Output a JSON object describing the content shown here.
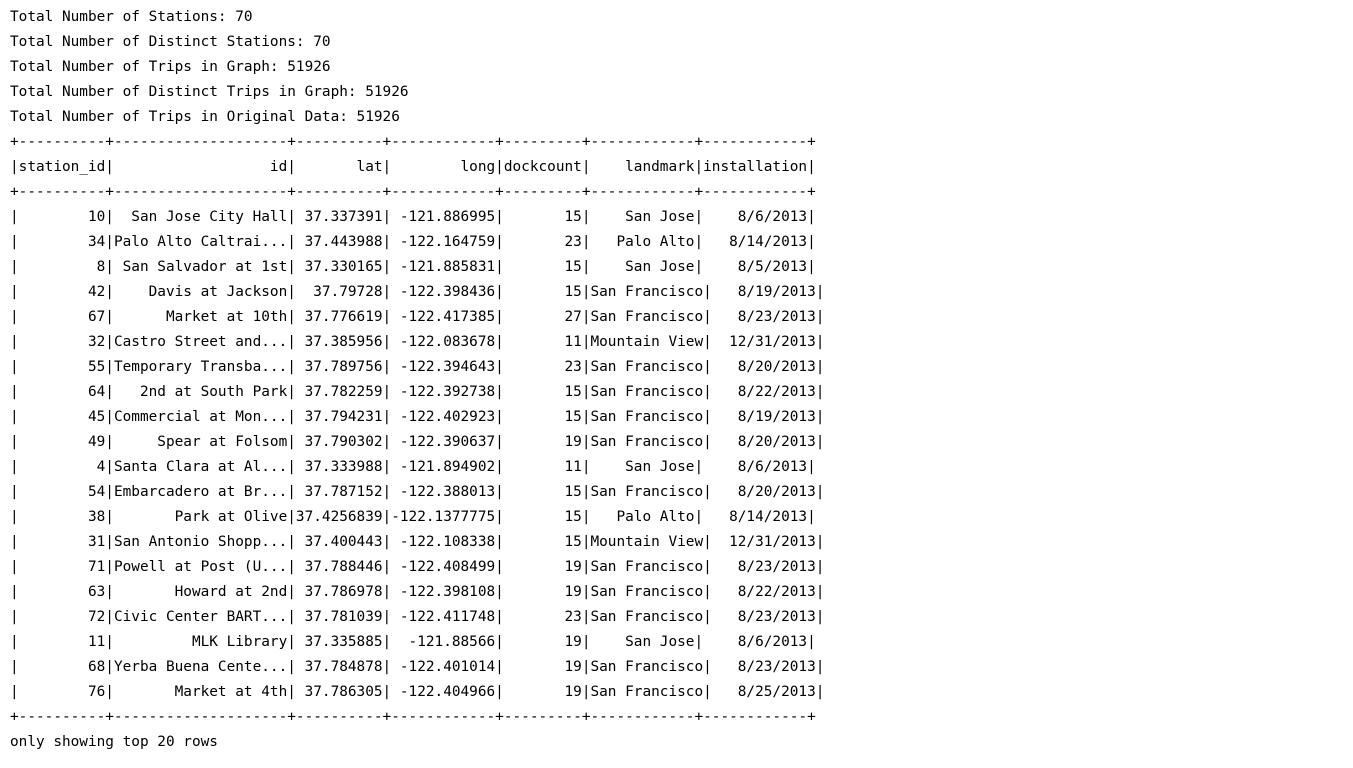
{
  "summary": [
    "Total Number of Stations: 70",
    "Total Number of Distinct Stations: 70",
    "Total Number of Trips in Graph: 51926",
    "Total Number of Distinct Trips in Graph: 51926",
    "Total Number of Trips in Original Data: 51926"
  ],
  "table": {
    "border": "+----------+--------------------+----------+------------+---------+------------+------------+",
    "header": "|station_id|                  id|       lat|        long|dockcount|    landmark|installation|",
    "rows": [
      "|        10|  San Jose City Hall| 37.337391| -121.886995|       15|    San Jose|    8/6/2013|",
      "|        34|Palo Alto Caltrai...| 37.443988| -122.164759|       23|   Palo Alto|   8/14/2013|",
      "|         8| San Salvador at 1st| 37.330165| -121.885831|       15|    San Jose|    8/5/2013|",
      "|        42|    Davis at Jackson|  37.79728| -122.398436|       15|San Francisco|   8/19/2013|",
      "|        67|      Market at 10th| 37.776619| -122.417385|       27|San Francisco|   8/23/2013|",
      "|        32|Castro Street and...| 37.385956| -122.083678|       11|Mountain View|  12/31/2013|",
      "|        55|Temporary Transba...| 37.789756| -122.394643|       23|San Francisco|   8/20/2013|",
      "|        64|   2nd at South Park| 37.782259| -122.392738|       15|San Francisco|   8/22/2013|",
      "|        45|Commercial at Mon...| 37.794231| -122.402923|       15|San Francisco|   8/19/2013|",
      "|        49|     Spear at Folsom| 37.790302| -122.390637|       19|San Francisco|   8/20/2013|",
      "|         4|Santa Clara at Al...| 37.333988| -121.894902|       11|    San Jose|    8/6/2013|",
      "|        54|Embarcadero at Br...| 37.787152| -122.388013|       15|San Francisco|   8/20/2013|",
      "|        38|       Park at Olive|37.4256839|-122.1377775|       15|   Palo Alto|   8/14/2013|",
      "|        31|San Antonio Shopp...| 37.400443| -122.108338|       15|Mountain View|  12/31/2013|",
      "|        71|Powell at Post (U...| 37.788446| -122.408499|       19|San Francisco|   8/23/2013|",
      "|        63|       Howard at 2nd| 37.786978| -122.398108|       19|San Francisco|   8/22/2013|",
      "|        72|Civic Center BART...| 37.781039| -122.411748|       23|San Francisco|   8/23/2013|",
      "|        11|         MLK Library| 37.335885|  -121.88566|       19|    San Jose|    8/6/2013|",
      "|        68|Yerba Buena Cente...| 37.784878| -122.401014|       19|San Francisco|   8/23/2013|",
      "|        76|       Market at 4th| 37.786305| -122.404966|       19|San Francisco|   8/25/2013|"
    ]
  },
  "footer": "only showing top 20 rows"
}
